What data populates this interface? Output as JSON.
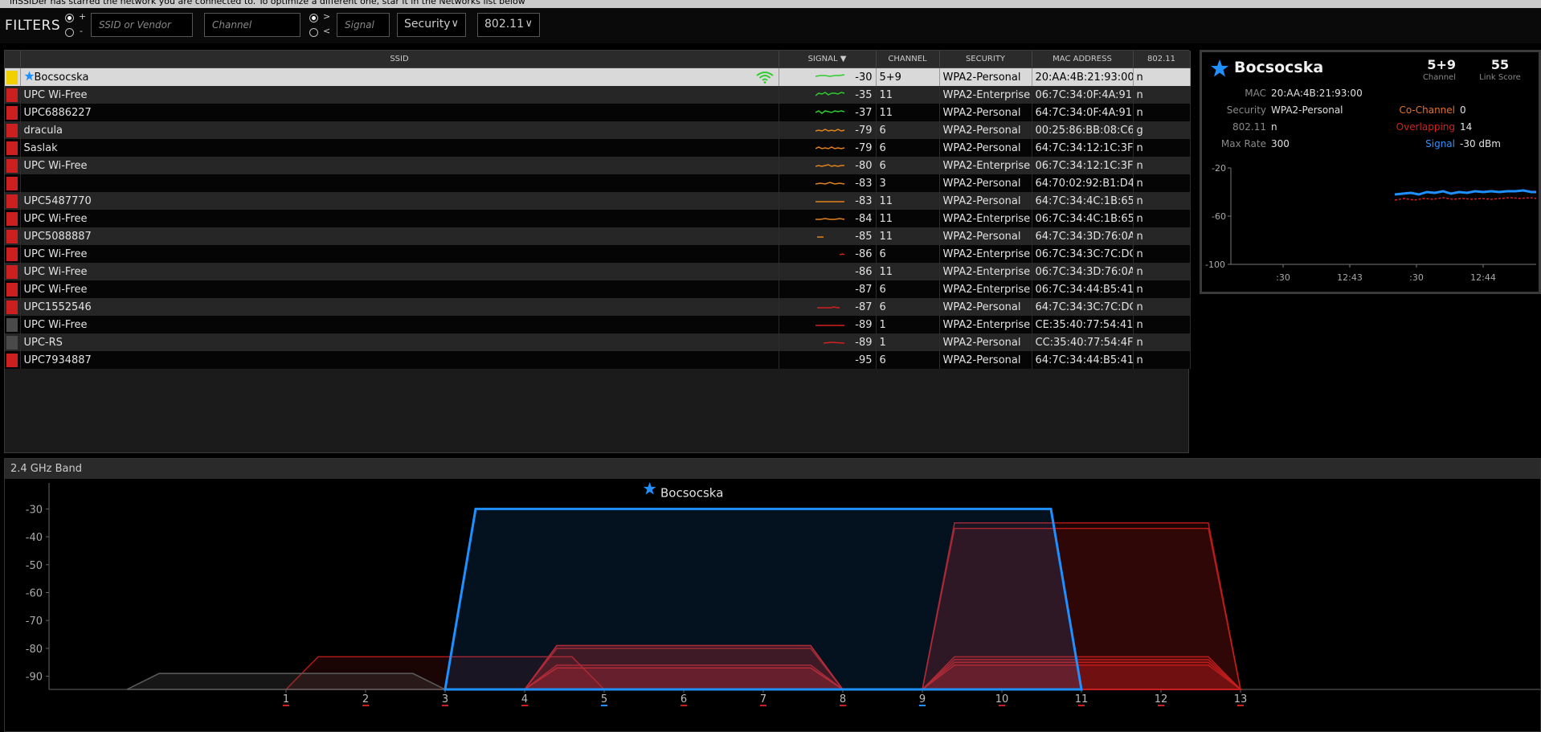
{
  "banner_text": "inSSIDer has starred the network you are connected to. To optimize a different one, star it in the Networks list below",
  "filters": {
    "label": "FILTERS",
    "op_plus": "+",
    "op_minus": "-",
    "op_gt": ">",
    "op_lt": "<",
    "ssid_placeholder": "SSID or Vendor",
    "channel_placeholder": "Channel",
    "signal_placeholder": "Signal",
    "security_label": "Security",
    "mode_label": "802.11"
  },
  "table": {
    "headers": {
      "ssid": "SSID",
      "signal": "SIGNAL",
      "channel": "CHANNEL",
      "security": "SECURITY",
      "mac": "MAC ADDRESS",
      "mode": "802.11"
    },
    "rows": [
      {
        "ssid": "Bocsocska",
        "starred": true,
        "signal": "-30",
        "channel": "5+9",
        "security": "WPA2-Personal",
        "mac": "20:AA:4B:21:93:00",
        "mode": "n",
        "color": "#f2d000",
        "spark": "#2ecc2e"
      },
      {
        "ssid": "UPC Wi-Free",
        "signal": "-35",
        "channel": "11",
        "security": "WPA2-Enterprise",
        "mac": "06:7C:34:0F:4A:91",
        "mode": "n",
        "color": "#cc1f1f",
        "spark": "#2ecc2e"
      },
      {
        "ssid": "UPC6886227",
        "signal": "-37",
        "channel": "11",
        "security": "WPA2-Personal",
        "mac": "64:7C:34:0F:4A:91",
        "mode": "n",
        "color": "#cc1f1f",
        "spark": "#2ecc2e"
      },
      {
        "ssid": "dracula",
        "signal": "-79",
        "channel": "6",
        "security": "WPA2-Personal",
        "mac": "00:25:86:BB:08:C6",
        "mode": "g",
        "color": "#cc1f1f",
        "spark": "#e0831c"
      },
      {
        "ssid": "Saslak",
        "signal": "-79",
        "channel": "6",
        "security": "WPA2-Personal",
        "mac": "64:7C:34:12:1C:3F",
        "mode": "n",
        "color": "#cc1f1f",
        "spark": "#e0831c"
      },
      {
        "ssid": "UPC Wi-Free",
        "signal": "-80",
        "channel": "6",
        "security": "WPA2-Enterprise",
        "mac": "06:7C:34:12:1C:3F",
        "mode": "n",
        "color": "#cc1f1f",
        "spark": "#e0831c"
      },
      {
        "ssid": "",
        "signal": "-83",
        "channel": "3",
        "security": "WPA2-Personal",
        "mac": "64:70:02:92:B1:D4",
        "mode": "n",
        "color": "#cc1f1f",
        "spark": "#e0831c"
      },
      {
        "ssid": "UPC5487770",
        "signal": "-83",
        "channel": "11",
        "security": "WPA2-Personal",
        "mac": "64:7C:34:4C:1B:65",
        "mode": "n",
        "color": "#cc1f1f",
        "spark": "#e0831c"
      },
      {
        "ssid": "UPC Wi-Free",
        "signal": "-84",
        "channel": "11",
        "security": "WPA2-Enterprise",
        "mac": "06:7C:34:4C:1B:65",
        "mode": "n",
        "color": "#cc1f1f",
        "spark": "#e0831c"
      },
      {
        "ssid": "UPC5088887",
        "signal": "-85",
        "channel": "11",
        "security": "WPA2-Personal",
        "mac": "64:7C:34:3D:76:0A",
        "mode": "n",
        "color": "#cc1f1f",
        "spark": "#e0831c"
      },
      {
        "ssid": "UPC Wi-Free",
        "signal": "-86",
        "channel": "6",
        "security": "WPA2-Enterprise",
        "mac": "06:7C:34:3C:7C:DC",
        "mode": "n",
        "color": "#cc1f1f",
        "spark": "#d42020"
      },
      {
        "ssid": "UPC Wi-Free",
        "signal": "-86",
        "channel": "11",
        "security": "WPA2-Enterprise",
        "mac": "06:7C:34:3D:76:0A",
        "mode": "n",
        "color": "#cc1f1f",
        "spark": "#d42020"
      },
      {
        "ssid": "UPC Wi-Free",
        "signal": "-87",
        "channel": "6",
        "security": "WPA2-Enterprise",
        "mac": "06:7C:34:44:B5:41",
        "mode": "n",
        "color": "#cc1f1f",
        "spark": "#d42020"
      },
      {
        "ssid": "UPC1552546",
        "signal": "-87",
        "channel": "6",
        "security": "WPA2-Personal",
        "mac": "64:7C:34:3C:7C:DC",
        "mode": "n",
        "color": "#cc1f1f",
        "spark": "#d42020"
      },
      {
        "ssid": "UPC Wi-Free",
        "signal": "-89",
        "channel": "1",
        "security": "WPA2-Enterprise",
        "mac": "CE:35:40:77:54:41",
        "mode": "n",
        "color": "#4a4a4a",
        "spark": "#d42020"
      },
      {
        "ssid": "UPC-RS",
        "signal": "-89",
        "channel": "1",
        "security": "WPA2-Personal",
        "mac": "CC:35:40:77:54:4F",
        "mode": "n",
        "color": "#4a4a4a",
        "spark": "#d42020"
      },
      {
        "ssid": "UPC7934887",
        "signal": "-95",
        "channel": "6",
        "security": "WPA2-Personal",
        "mac": "64:7C:34:44:B5:41",
        "mode": "n",
        "color": "#cc1f1f",
        "spark": "#d42020"
      }
    ]
  },
  "detail": {
    "ssid": "Bocsocska",
    "channel_value": "5+9",
    "channel_caption": "Channel",
    "link_score_value": "55",
    "link_score_caption": "Link Score",
    "mac_label": "MAC",
    "mac_value": "20:AA:4B:21:93:00",
    "security_label": "Security",
    "security_value": "WPA2-Personal",
    "mode_label": "802.11",
    "mode_value": "n",
    "maxrate_label": "Max Rate",
    "maxrate_value": "300",
    "cochannel_label": "Co-Channel",
    "cochannel_value": "0",
    "overlapping_label": "Overlapping",
    "overlapping_value": "14",
    "signal_label": "Signal",
    "signal_value": "-30 dBm",
    "graph_y_ticks": [
      "-20",
      "-60",
      "-100"
    ],
    "graph_x_ticks": [
      ":30",
      "12:43",
      ":30",
      "12:44"
    ]
  },
  "colors": {
    "accent": "#1e90ff",
    "selected": "#f2d000",
    "overlap": "#cc1f1f",
    "neutral": "#4a4a4a",
    "orange": "#e8702a"
  },
  "chart_data": {
    "type": "area",
    "title": "2.4 GHz Band",
    "xlabel": "",
    "ylabel": "",
    "ylim": [
      -95,
      -25
    ],
    "y_ticks": [
      -30,
      -40,
      -50,
      -60,
      -70,
      -80,
      -90
    ],
    "x_ticks": [
      1,
      2,
      3,
      4,
      5,
      6,
      7,
      8,
      9,
      10,
      11,
      12,
      13
    ],
    "series": [
      {
        "name": "Bocsocska",
        "starred": true,
        "channel_low": 3,
        "channel_high": 11,
        "signal": -30,
        "color": "#1e90ff"
      },
      {
        "channel_low": 9,
        "channel_high": 13,
        "signal": -35,
        "color": "#cc1f1f"
      },
      {
        "channel_low": 9,
        "channel_high": 13,
        "signal": -37,
        "color": "#cc1f1f"
      },
      {
        "channel_low": 4,
        "channel_high": 8,
        "signal": -79,
        "color": "#cc1f1f"
      },
      {
        "channel_low": 4,
        "channel_high": 8,
        "signal": -79,
        "color": "#cc1f1f"
      },
      {
        "channel_low": 4,
        "channel_high": 8,
        "signal": -80,
        "color": "#cc1f1f"
      },
      {
        "channel_low": 1,
        "channel_high": 5,
        "signal": -83,
        "color": "#cc1f1f"
      },
      {
        "channel_low": 9,
        "channel_high": 13,
        "signal": -83,
        "color": "#cc1f1f"
      },
      {
        "channel_low": 9,
        "channel_high": 13,
        "signal": -84,
        "color": "#cc1f1f"
      },
      {
        "channel_low": 9,
        "channel_high": 13,
        "signal": -85,
        "color": "#cc1f1f"
      },
      {
        "channel_low": 4,
        "channel_high": 8,
        "signal": -86,
        "color": "#cc1f1f"
      },
      {
        "channel_low": 9,
        "channel_high": 13,
        "signal": -86,
        "color": "#cc1f1f"
      },
      {
        "channel_low": 4,
        "channel_high": 8,
        "signal": -87,
        "color": "#cc1f1f"
      },
      {
        "channel_low": 4,
        "channel_high": 8,
        "signal": -87,
        "color": "#cc1f1f"
      },
      {
        "channel_low": -1,
        "channel_high": 3,
        "signal": -89,
        "color": "#5a5a5a"
      },
      {
        "channel_low": -1,
        "channel_high": 3,
        "signal": -89,
        "color": "#5a5a5a"
      }
    ]
  }
}
